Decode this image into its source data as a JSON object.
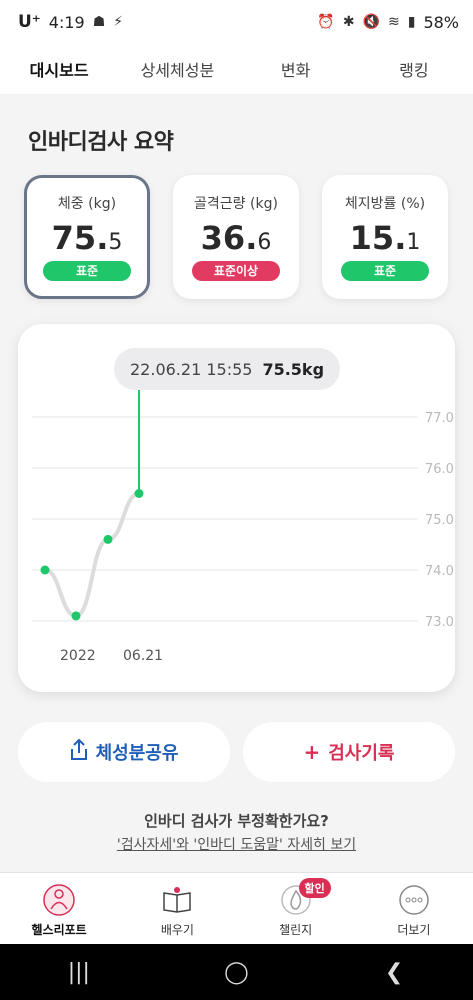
{
  "status_bar": {
    "carrier": "U⁺",
    "time": "4:19",
    "battery": "58%"
  },
  "tabs": [
    {
      "label": "대시보드",
      "active": true
    },
    {
      "label": "상세체성분",
      "active": false
    },
    {
      "label": "변화",
      "active": false
    },
    {
      "label": "랭킹",
      "active": false
    }
  ],
  "summary": {
    "title": "인바디검사 요약",
    "cards": [
      {
        "label": "체중 (kg)",
        "int": "75",
        "dec": "5",
        "badge": "표준",
        "badge_color": "#1fc66a"
      },
      {
        "label": "골격근량 (kg)",
        "int": "36",
        "dec": "6",
        "badge": "표준이상",
        "badge_color": "#e23b62"
      },
      {
        "label": "체지방률 (%)",
        "int": "15",
        "dec": "1",
        "badge": "표준",
        "badge_color": "#1fc66a"
      }
    ]
  },
  "chart": {
    "tooltip_date": "22.06.21 15:55",
    "tooltip_value": "75.5kg"
  },
  "chart_data": {
    "type": "line",
    "ylim": [
      72.8,
      77.3
    ],
    "yticks": [
      "77.0",
      "76.0",
      "75.0",
      "74.0",
      "73.0"
    ],
    "xticks": [
      "2022",
      "06.21"
    ],
    "points": [
      74.0,
      73.1,
      74.6,
      75.5
    ],
    "selected_index": 3,
    "line_color": "#dcdcdc",
    "point_color": "#1fc66a"
  },
  "actions": {
    "share_label": "체성분공유",
    "record_label": "검사기록"
  },
  "info": {
    "question": "인바디 검사가 부정확한가요?",
    "link": "'검사자세'와 '인바디 도움말' 자세히 보기"
  },
  "bottom_nav": [
    {
      "label": "헬스리포트",
      "icon": "health-report-icon",
      "active": true
    },
    {
      "label": "배우기",
      "icon": "book-icon",
      "active": false
    },
    {
      "label": "챌린지",
      "icon": "flame-icon",
      "active": false,
      "badge": "할인"
    },
    {
      "label": "더보기",
      "icon": "more-icon",
      "active": false
    }
  ]
}
